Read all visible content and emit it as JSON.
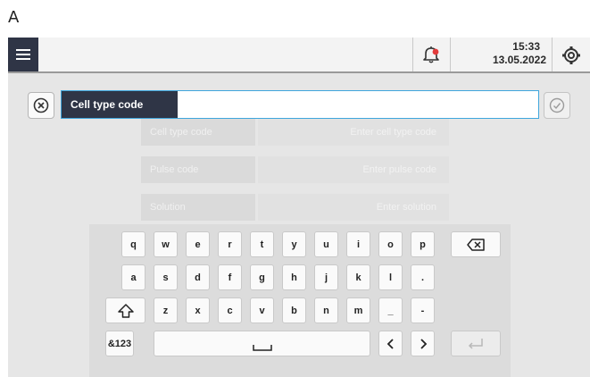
{
  "figure_label": "A",
  "topbar": {
    "time": "15:33",
    "date": "13.05.2022",
    "menu_icon": "hamburger-menu-icon",
    "notification_icon": "bell-alert-icon",
    "settings_icon": "settings-gear-icon",
    "accent_color": "#2f3546",
    "alert_color": "#e23b3b"
  },
  "input": {
    "label": "Cell type code",
    "value": "",
    "clear_icon": "clear-circle-x-icon",
    "confirm_icon": "confirm-check-icon",
    "focus_color": "#3fa6dd"
  },
  "background_form": {
    "rows": [
      {
        "label": "Cell type code",
        "value": "Enter cell type code"
      },
      {
        "label": "Pulse code",
        "value": "Enter pulse code"
      },
      {
        "label": "Solution",
        "value": "Enter solution"
      }
    ]
  },
  "keyboard": {
    "row1": [
      "q",
      "w",
      "e",
      "r",
      "t",
      "y",
      "u",
      "i",
      "o",
      "p"
    ],
    "row2": [
      "a",
      "s",
      "d",
      "f",
      "g",
      "h",
      "j",
      "k",
      "l",
      "."
    ],
    "row3": [
      "z",
      "x",
      "c",
      "v",
      "b",
      "n",
      "m",
      "_",
      "-"
    ],
    "mode_key": "&123",
    "backspace_icon": "backspace-icon",
    "shift_icon": "shift-arrow-icon",
    "space_icon": "space-bar-icon",
    "left_icon": "chevron-left-icon",
    "right_icon": "chevron-right-icon",
    "enter_icon": "enter-return-icon"
  }
}
